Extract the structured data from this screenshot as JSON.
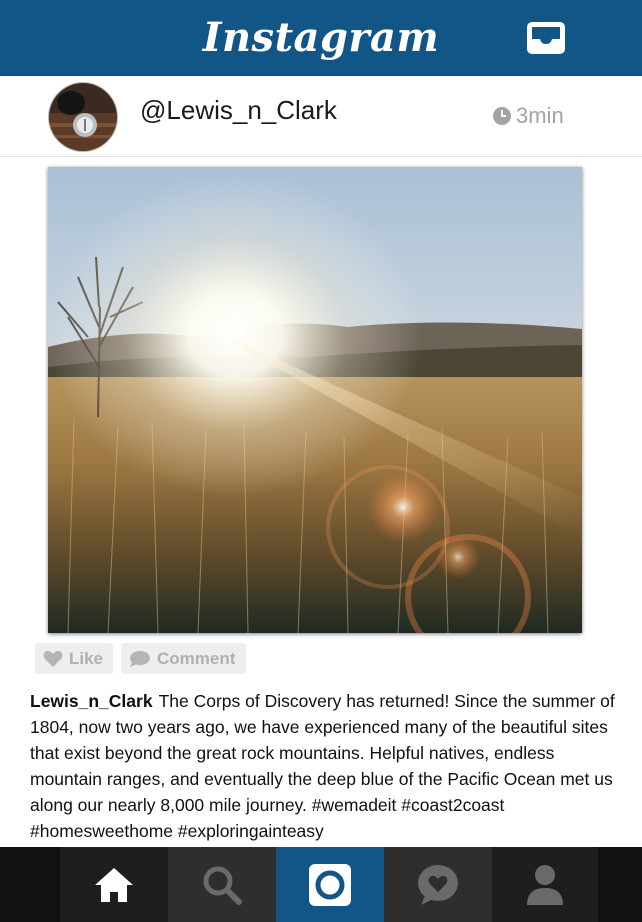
{
  "header": {
    "logo_text": "Instagram",
    "inbox_icon": "inbox-tray-icon",
    "bar_color": "#125688"
  },
  "post": {
    "username": "@Lewis_n_Clark",
    "time_icon": "clock-icon",
    "time": "3min",
    "photo_icon": "landscape-sunset-photo",
    "actions": {
      "like_label": "Like",
      "comment_label": "Comment"
    },
    "caption": {
      "author": "Lewis_n_Clark",
      "text": "The Corps of Discovery has returned! Since the summer of 1804, now two years ago, we have experienced  many of the beautiful sites that exist beyond the great rock mountains. Helpful natives, endless mountain ranges, and eventually the deep blue of the Pacific Ocean met us along our nearly 8,000 mile journey. #wemadeit #coast2coast #homesweethome #exploringainteasy"
    }
  },
  "bottom_nav": {
    "tabs": [
      {
        "name": "home",
        "icon": "home-icon"
      },
      {
        "name": "search",
        "icon": "search-icon"
      },
      {
        "name": "camera",
        "icon": "camera-icon",
        "active": true
      },
      {
        "name": "activity",
        "icon": "heart-bubble-icon"
      },
      {
        "name": "profile",
        "icon": "profile-icon"
      }
    ],
    "active_color": "#125688"
  }
}
